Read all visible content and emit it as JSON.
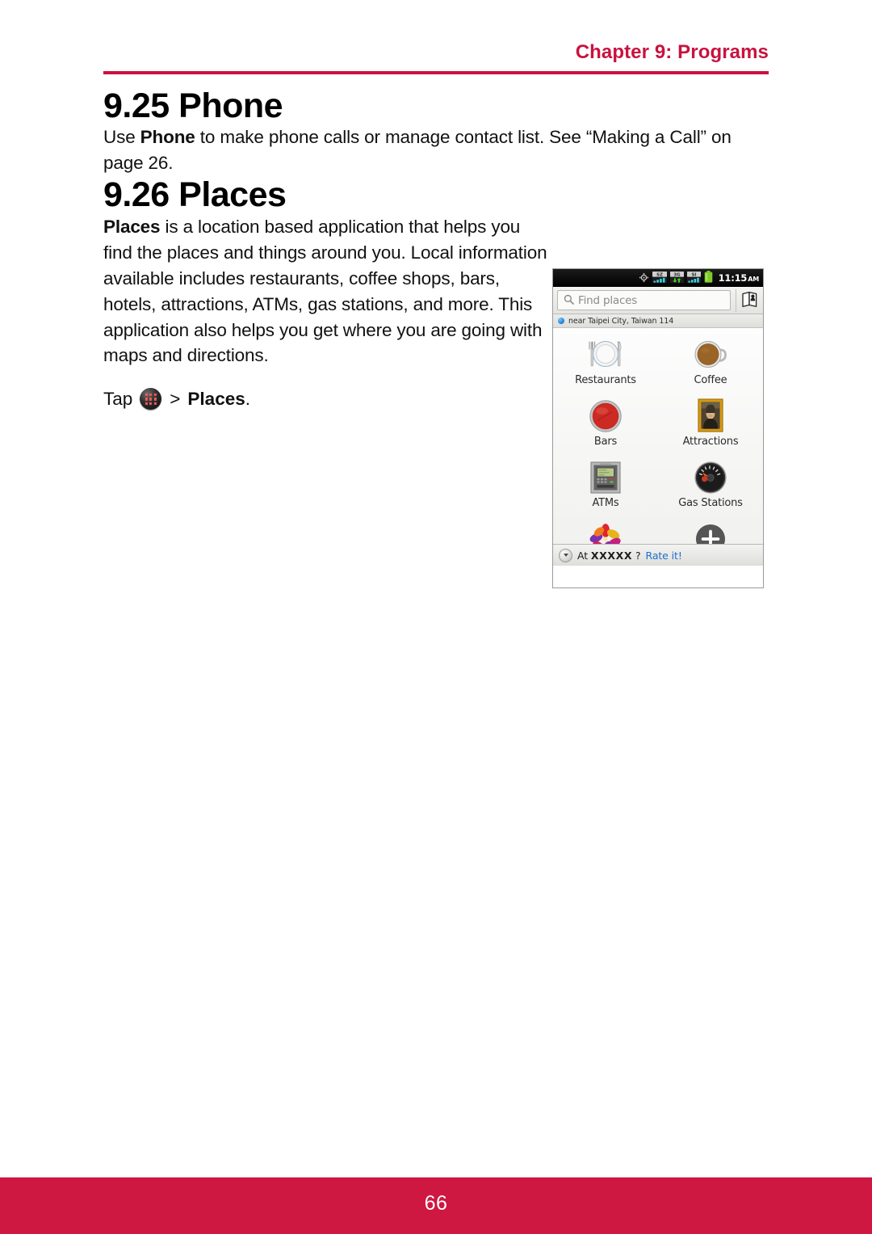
{
  "header": {
    "chapter": "Chapter 9: Programs",
    "rule_color": "#c9123f"
  },
  "sections": [
    {
      "heading": "9.25 Phone",
      "paragraph_prefix": "Use ",
      "paragraph_bold": "Phone",
      "paragraph_suffix": " to make phone calls or manage contact list. See “Making a Call” on page 26."
    },
    {
      "heading": "9.26 Places",
      "paragraph_bold": "Places",
      "paragraph_suffix": " is a location based application that helps you find the places and things around you. Local information available includes restaurants, coffee shops, bars, hotels, attractions, ATMs, gas stations, and more. This application also helps you get where you are going with maps and directions.",
      "tap_instruction": {
        "tap_word": "Tap",
        "separator": ">",
        "target": "Places",
        "period": ".",
        "icon": "app-drawer-icon"
      }
    }
  ],
  "phone_screenshot": {
    "statusbar": {
      "icons": [
        "gps-crosshair-icon",
        "signal-bars-icon",
        "data-3g-icon",
        "signal-bars-secondary-icon",
        "battery-icon"
      ],
      "clock_time": "11:15",
      "clock_ampm": "AM"
    },
    "search": {
      "placeholder": "Find places",
      "search_icon": "magnifier-icon",
      "map_button_icon": "map-book-icon"
    },
    "location": {
      "indicator_icon": "blue-location-dot-icon",
      "text": "near Taipei City, Taiwan 114"
    },
    "categories": [
      {
        "label": "Restaurants",
        "icon": "plate-utensils-icon"
      },
      {
        "label": "Coffee",
        "icon": "coffee-cup-icon"
      },
      {
        "label": "Bars",
        "icon": "bottle-cap-icon"
      },
      {
        "label": "Attractions",
        "icon": "framed-painting-icon"
      },
      {
        "label": "ATMs",
        "icon": "atm-machine-icon"
      },
      {
        "label": "Gas Stations",
        "icon": "fuel-gauge-icon"
      },
      {
        "label": "",
        "icon": "pinwheel-flower-icon"
      },
      {
        "label": "",
        "icon": "plus-circle-icon"
      }
    ],
    "ratebar": {
      "expand_icon": "chevron-down-circle-icon",
      "prompt_prefix": "At ",
      "prompt_placeholder": "XXXXX",
      "prompt_suffix": " ?",
      "link_label": "Rate it!",
      "link_color": "#1e6fd0"
    }
  },
  "footer": {
    "page_number": "66",
    "band_color": "#ce1741"
  }
}
